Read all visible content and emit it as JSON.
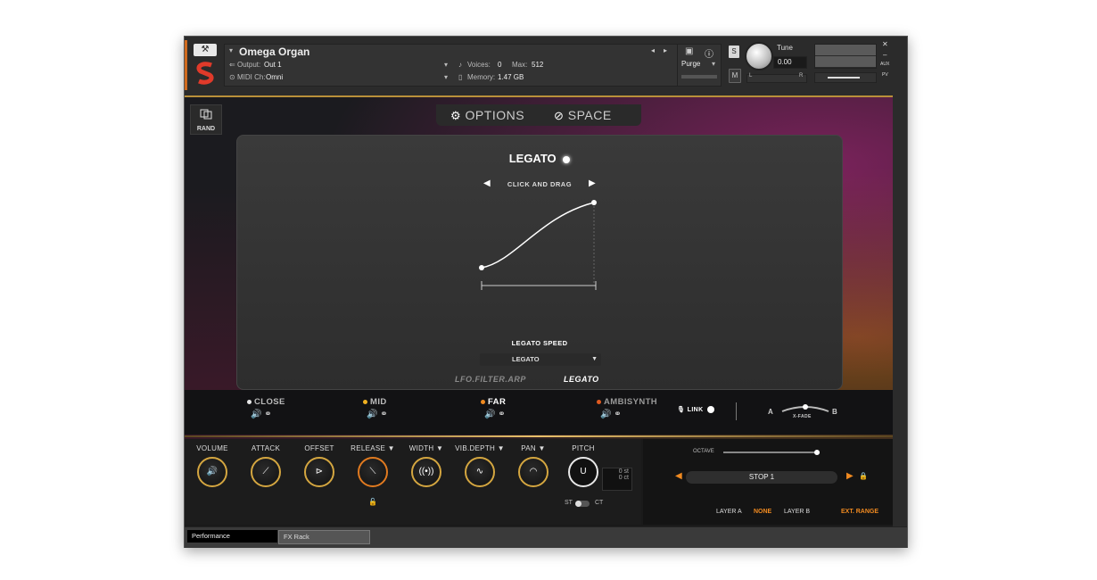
{
  "header": {
    "instrument_name": "Omega Organ",
    "output_label": "Output:",
    "output_value": "Out 1",
    "midi_label": "MIDI Ch:",
    "midi_value": "Omni",
    "voices_label": "Voices:",
    "voices_value": "0",
    "max_label": "Max:",
    "max_value": "512",
    "memory_label": "Memory:",
    "memory_value": "1.47 GB",
    "purge_label": "Purge",
    "tune_label": "Tune",
    "tune_value": "0.00",
    "solo_label": "S",
    "mute_label": "M",
    "pan_left": "L",
    "pan_right": "R",
    "aux_label": "AUX",
    "pv_label": "PV"
  },
  "nav": {
    "rand_label": "RAND",
    "tabs": [
      "OPTIONS",
      "SPACE"
    ]
  },
  "legato_panel": {
    "title": "LEGATO",
    "instruction": "CLICK AND DRAG",
    "speed_label": "LEGATO SPEED",
    "speed_value": "LEGATO",
    "sub_tabs": [
      "LFO.FILTER.ARP",
      "LEGATO"
    ]
  },
  "mics": [
    {
      "label": "CLOSE",
      "color": "#e6e6e6"
    },
    {
      "label": "MID",
      "color": "#f0b020"
    },
    {
      "label": "FAR",
      "color": "#f08a20"
    },
    {
      "label": "AMBISYNTH",
      "color": "#e05a20"
    }
  ],
  "mic_strip": {
    "link_label": "LINK",
    "xfade_a": "A",
    "xfade_b": "B",
    "xfade_label": "X-FADE"
  },
  "controls": [
    {
      "label": "VOLUME",
      "icon": "speaker-icon"
    },
    {
      "label": "ATTACK",
      "icon": "ramp-icon"
    },
    {
      "label": "OFFSET",
      "icon": "offset-icon"
    },
    {
      "label": "RELEASE ▼",
      "icon": "release-icon"
    },
    {
      "label": "WIDTH ▼",
      "icon": "width-icon"
    },
    {
      "label": "VIB.DEPTH ▼",
      "icon": "vibrato-icon"
    },
    {
      "label": "PAN ▼",
      "icon": "pan-icon"
    },
    {
      "label": "PITCH",
      "icon": "pitch-icon"
    }
  ],
  "pitch": {
    "st_value": "0 st",
    "ct_value": "0 ct",
    "st_label": "ST",
    "ct_label": "CT"
  },
  "layer_panel": {
    "octave_label": "OCTAVE",
    "stop_value": "STOP 1",
    "layer_a": "LAYER A",
    "none_label": "NONE",
    "layer_b": "LAYER B",
    "ext_range": "EXT. RANGE"
  },
  "footer": {
    "tabs": [
      "Performance",
      "FX Rack"
    ]
  },
  "colors": {
    "accent_gold": "#d4a640",
    "accent_orange": "#f08a20"
  }
}
